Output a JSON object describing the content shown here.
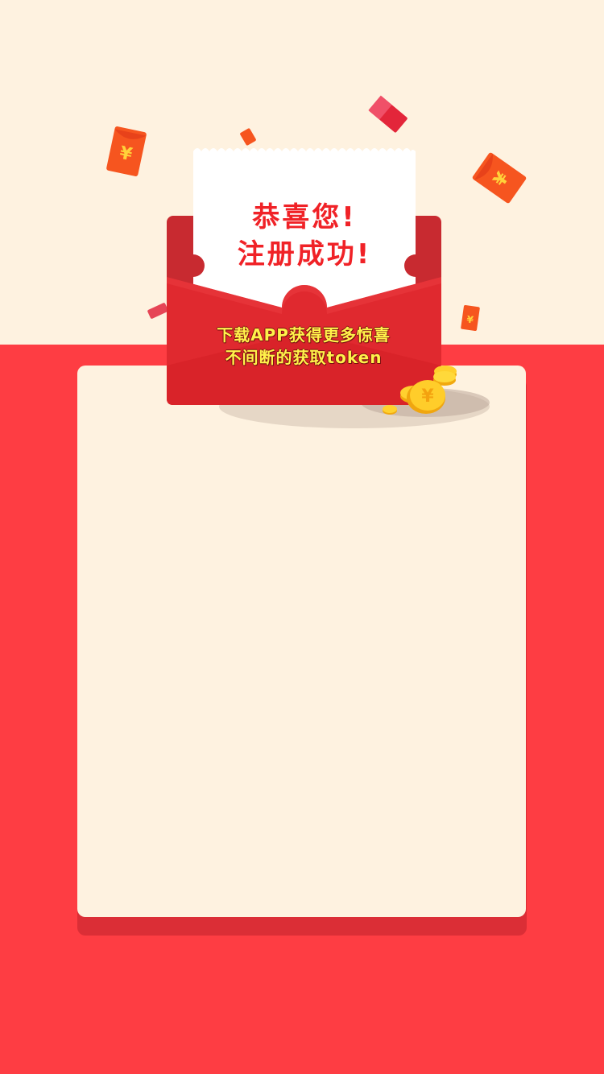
{
  "hero": {
    "title_line1": "恭喜您!",
    "title_line2": "注册成功!"
  },
  "promo": {
    "line1": "下载APP获得更多惊喜",
    "line2": "不间断的获取token"
  },
  "decor": {
    "currency_symbol": "¥"
  },
  "colors": {
    "top_background": "#FEF2E0",
    "bottom_background": "#FE3D43",
    "card": "#FEF2E0",
    "envelope": "#E0292F",
    "title": "#F02227",
    "promo_text": "#FFF24A",
    "coin": "#FFC928"
  }
}
